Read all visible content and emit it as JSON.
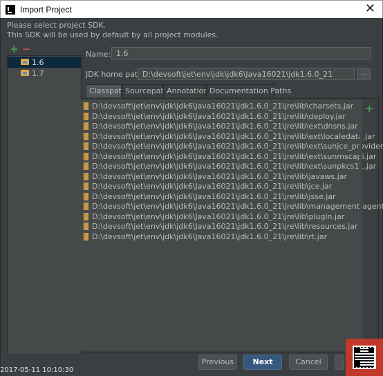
{
  "window": {
    "title": "Import Project"
  },
  "hint": {
    "line1": "Please select project SDK.",
    "line2": "This SDK will be used by default by all project modules."
  },
  "sdks": [
    {
      "label": "1.6",
      "selected": true
    },
    {
      "label": "1.7",
      "selected": false
    }
  ],
  "form": {
    "name_label": "Name:",
    "name_value": "1.6",
    "home_label": "JDK home path:",
    "home_value": "D:\\devsoft\\jet\\env\\jdk\\jdk6\\Java16021\\jdk1.6.0_21",
    "browse_label": "..."
  },
  "tabs": [
    {
      "label": "Classpath",
      "active": true
    },
    {
      "label": "Sourcepath",
      "active": false
    },
    {
      "label": "Annotations",
      "active": false
    },
    {
      "label": "Documentation Paths",
      "active": false
    }
  ],
  "classpath": [
    "D:\\devsoft\\jet\\env\\jdk\\jdk6\\Java16021\\jdk1.6.0_21\\jre\\lib\\charsets.jar",
    "D:\\devsoft\\jet\\env\\jdk\\jdk6\\Java16021\\jdk1.6.0_21\\jre\\lib\\deploy.jar",
    "D:\\devsoft\\jet\\env\\jdk\\jdk6\\Java16021\\jdk1.6.0_21\\jre\\lib\\ext\\dnsns.jar",
    "D:\\devsoft\\jet\\env\\jdk\\jdk6\\Java16021\\jdk1.6.0_21\\jre\\lib\\ext\\localedata.jar",
    "D:\\devsoft\\jet\\env\\jdk\\jdk6\\Java16021\\jdk1.6.0_21\\jre\\lib\\ext\\sunjce_provider.jar",
    "D:\\devsoft\\jet\\env\\jdk\\jdk6\\Java16021\\jdk1.6.0_21\\jre\\lib\\ext\\sunmscapi.jar",
    "D:\\devsoft\\jet\\env\\jdk\\jdk6\\Java16021\\jdk1.6.0_21\\jre\\lib\\ext\\sunpkcs11.jar",
    "D:\\devsoft\\jet\\env\\jdk\\jdk6\\Java16021\\jdk1.6.0_21\\jre\\lib\\javaws.jar",
    "D:\\devsoft\\jet\\env\\jdk\\jdk6\\Java16021\\jdk1.6.0_21\\jre\\lib\\jce.jar",
    "D:\\devsoft\\jet\\env\\jdk\\jdk6\\Java16021\\jdk1.6.0_21\\jre\\lib\\jsse.jar",
    "D:\\devsoft\\jet\\env\\jdk\\jdk6\\Java16021\\jdk1.6.0_21\\jre\\lib\\management-agent.jar",
    "D:\\devsoft\\jet\\env\\jdk\\jdk6\\Java16021\\jdk1.6.0_21\\jre\\lib\\plugin.jar",
    "D:\\devsoft\\jet\\env\\jdk\\jdk6\\Java16021\\jdk1.6.0_21\\jre\\lib\\resources.jar",
    "D:\\devsoft\\jet\\env\\jdk\\jdk6\\Java16021\\jdk1.6.0_21\\jre\\lib\\rt.jar"
  ],
  "buttons": {
    "previous": "Previous",
    "next": "Next",
    "cancel": "Cancel"
  },
  "timestamp": "2017-05-11 10:10:30",
  "colors": {
    "background": "#3c3f41",
    "selection": "#0d293e",
    "add": "#499c54",
    "remove": "#c75450",
    "primary_button": "#365880"
  }
}
